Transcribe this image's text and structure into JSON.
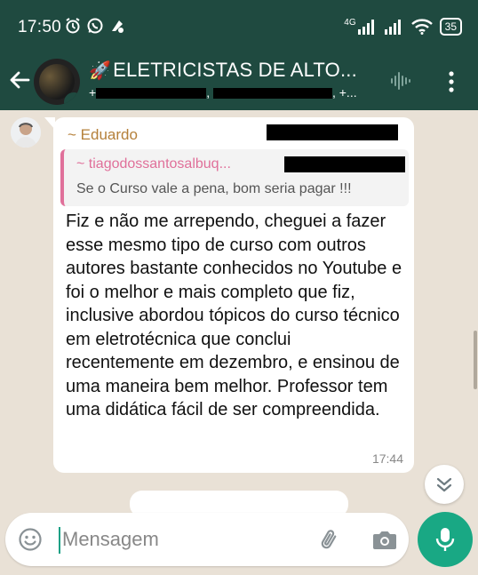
{
  "status_bar": {
    "time": "17:50",
    "network": "4G",
    "battery": "35"
  },
  "header": {
    "title": "ELETRICISTAS DE ALTO...",
    "subtitle_prefix": "+",
    "subtitle_sep1": ",",
    "subtitle_sep2": ",",
    "subtitle_suffix": "+..."
  },
  "message": {
    "sender": "~ Eduardo",
    "quoted_sender": "~ tiagodossantosalbuq...",
    "quoted_text": "Se o Curso vale a pena, bom seria pagar !!!",
    "text": "Fiz e não me arrependo, cheguei a fazer esse mesmo tipo de curso com outros autores bastante conhecidos no Youtube e foi o melhor e mais completo que fiz, inclusive abordou tópicos do curso técnico em eletrotécnica que conclui recentemente em dezembro, e ensinou de uma maneira bem melhor. Professor tem uma didática fácil de ser compreendida.",
    "time": "17:44"
  },
  "composer": {
    "placeholder": "Mensagem"
  },
  "colors": {
    "header_bg": "#1f4a40",
    "chat_bg": "#e9e1d6",
    "sender_name": "#b5803a",
    "quote_accent": "#e0709a",
    "send_button": "#19a884"
  },
  "icons": [
    "alarm-icon",
    "whatsapp-icon",
    "notification-icon",
    "signal-icon",
    "wifi-icon",
    "back-arrow-icon",
    "rocket-icon",
    "voice-wave-icon",
    "more-vert-icon",
    "chevron-down-icon",
    "emoji-icon",
    "attach-icon",
    "camera-icon",
    "mic-icon"
  ]
}
